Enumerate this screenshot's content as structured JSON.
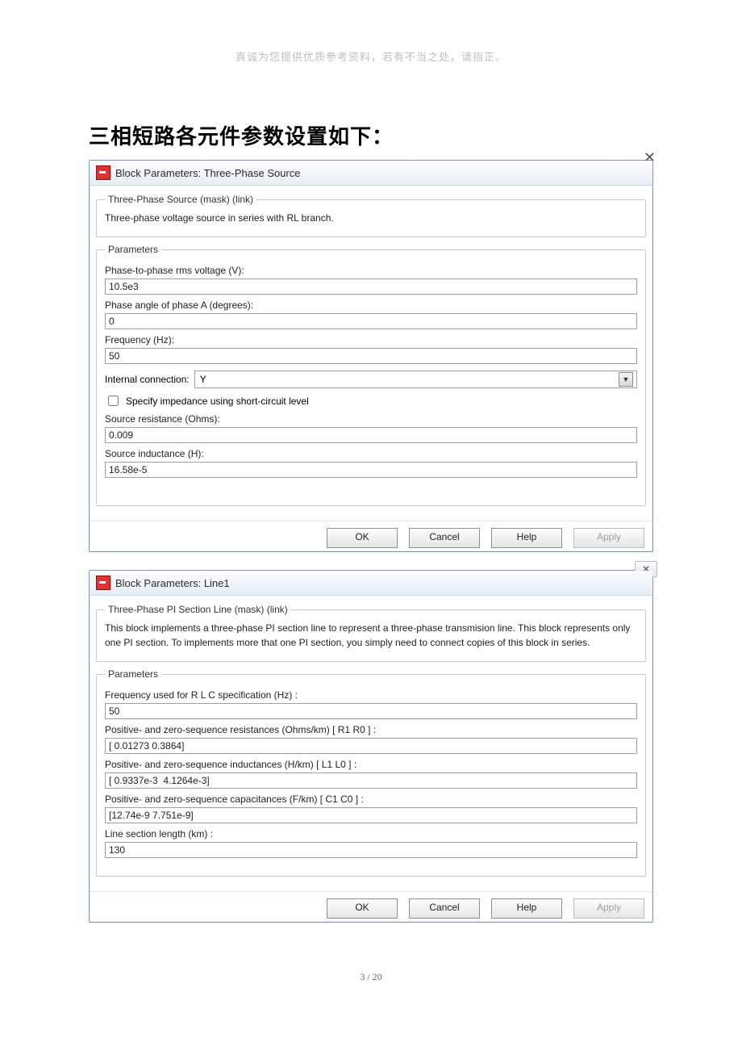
{
  "page": {
    "top_note": "真诚为您提供优质参考资料，若有不当之处，请指正。",
    "heading": "三相短路各元件参数设置如下：",
    "footer": "3 / 20"
  },
  "dialog1": {
    "title": "Block Parameters: Three-Phase Source",
    "close": "✕",
    "mask_legend": "Three-Phase Source (mask) (link)",
    "mask_desc": "Three-phase voltage source in series with RL branch.",
    "params_legend": "Parameters",
    "rms_label": "Phase-to-phase rms voltage (V):",
    "rms_value": "10.5e3",
    "angle_label": "Phase angle of phase A (degrees):",
    "angle_value": "0",
    "freq_label": "Frequency (Hz):",
    "freq_value": "50",
    "intconn_label": "Internal connection:",
    "intconn_value": "Y",
    "specify_label": "Specify impedance using short-circuit level",
    "srcres_label": "Source resistance (Ohms):",
    "srcres_value": "0.009",
    "srcind_label": "Source inductance (H):",
    "srcind_value": "16.58e-5",
    "ok": "OK",
    "cancel": "Cancel",
    "help": "Help",
    "apply": "Apply"
  },
  "dialog2": {
    "title": "Block Parameters:  Line1",
    "close": "✕",
    "mask_legend": "Three-Phase PI Section Line (mask) (link)",
    "mask_desc": "This block implements a three-phase PI section line to represent a three-phase transmision line. This block represents only  one PI section.  To implements more that one PI section,  you  simply need to connect  copies of this block in series.",
    "params_legend": "Parameters",
    "freq_label": "Frequency used for R L C specification (Hz) :",
    "freq_value": "50",
    "res_label": "Positive- and zero-sequence resistances (Ohms/km)  [ R1  R0 ] :",
    "res_value": "[ 0.01273 0.3864]",
    "ind_label": "Positive- and zero-sequence inductances (H/km) [ L1  L0 ] :",
    "ind_value": "[ 0.9337e-3  4.1264e-3]",
    "cap_label": "Positive- and zero-sequence capacitances (F/km)  [ C1 C0 ] :",
    "cap_value": "[12.74e-9 7.751e-9]",
    "len_label": "Line section length (km) :",
    "len_value": "130",
    "ok": "OK",
    "cancel": "Cancel",
    "help": "Help",
    "apply": "Apply"
  }
}
